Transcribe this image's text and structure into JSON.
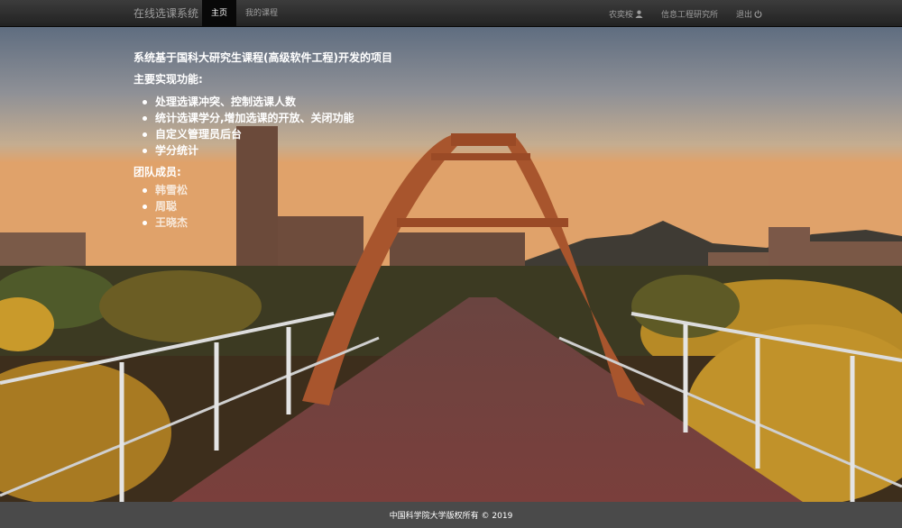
{
  "navbar": {
    "brand": "在线选课系统",
    "left_items": [
      {
        "label": "主页",
        "active": true
      },
      {
        "label": "我的课程",
        "active": false
      }
    ],
    "right_items": [
      {
        "label": "农奕桉",
        "icon": "user-icon"
      },
      {
        "label": "信息工程研究所",
        "icon": null
      },
      {
        "label": "退出",
        "icon": "power-icon"
      }
    ]
  },
  "hero": {
    "title": "系统基于国科大研究生课程(高级软件工程)开发的项目",
    "features_label": "主要实现功能:",
    "features": [
      "处理选课冲突、控制选课人数",
      "统计选课学分,增加选课的开放、关闭功能",
      "自定义管理员后台",
      "学分统计"
    ],
    "team_label": "团队成员:",
    "members": [
      "韩雪松",
      "周聪",
      "王晓杰"
    ]
  },
  "footer": {
    "copyright": "中国科学院大学版权所有 © 2019"
  },
  "colors": {
    "navbar_bg": "#222222",
    "active_tab_bg": "#080808",
    "nav_text": "#9d9d9d",
    "footer_bg": "#4a4a4a"
  }
}
